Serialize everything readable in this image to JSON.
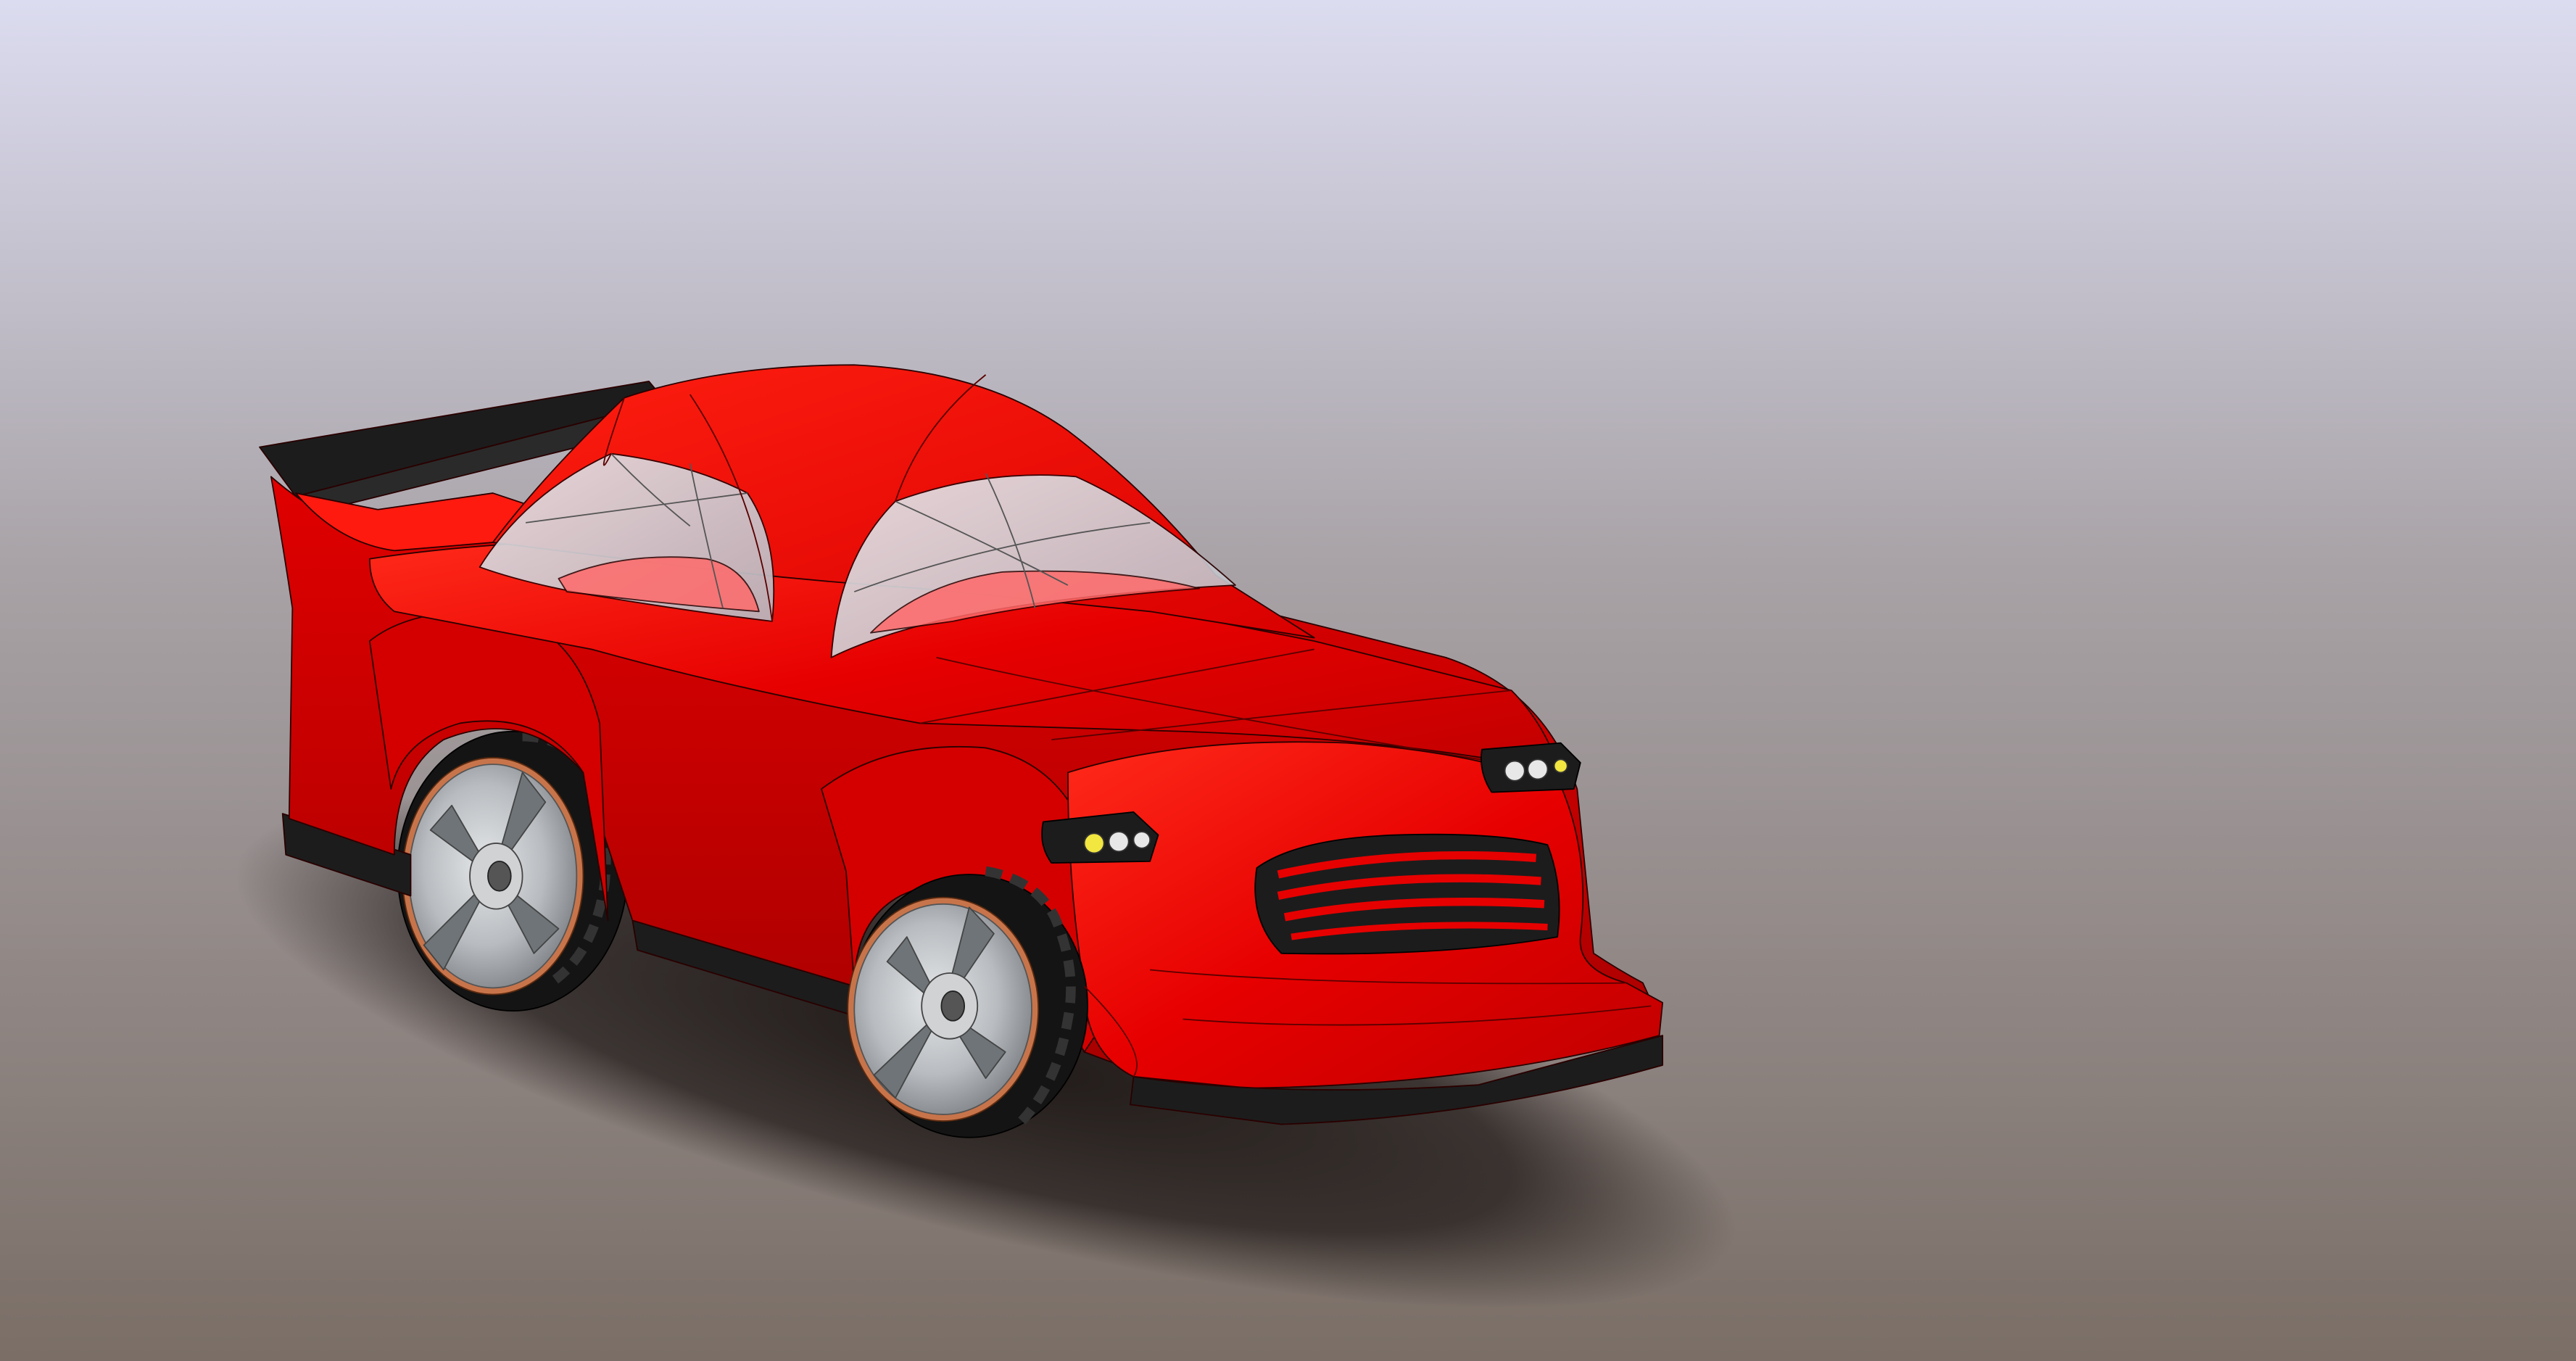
{
  "viewport": {
    "name": "3d-cad-viewport",
    "background_top": "#dcdcf0",
    "background_mid": "#a8a2a6",
    "background_bottom": "#7a6e66"
  },
  "model": {
    "name": "red-cartoon-race-car",
    "colors": {
      "body_red": "#e60000",
      "body_red_light": "#ff2a1a",
      "body_red_dark": "#a80000",
      "trim_black": "#1c1c1c",
      "glass": "#d9d9de",
      "interior_pink": "#ff6a6a",
      "rim_silver": "#b8bcc0",
      "rim_dark": "#6f7478",
      "tire_black": "#141414",
      "rim_copper": "#c8744a",
      "headlight_lens": "#e8e8e8",
      "headlight_yellow": "#f2e640",
      "shadow": "#1a1412"
    }
  }
}
